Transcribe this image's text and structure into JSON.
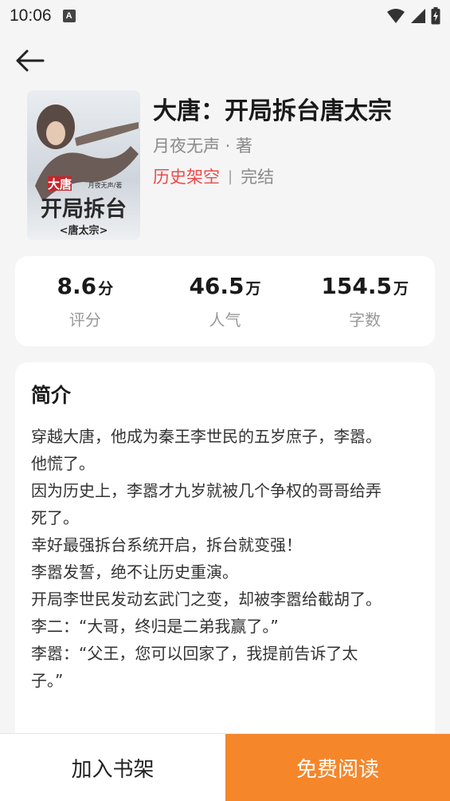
{
  "status_bar": {
    "time": "10:06",
    "notification_letter": "A",
    "icons": [
      "wifi-icon",
      "cell-signal-icon",
      "battery-icon"
    ]
  },
  "header": {
    "back_icon": "arrow-left-icon"
  },
  "book": {
    "cover_texts": {
      "big": "大唐",
      "main": "开局拆台",
      "sub": "<唐太宗>",
      "author": "月夜无声/著"
    },
    "title": "大唐：开局拆台唐太宗",
    "author": "月夜无声 · 著",
    "category": "历史架空",
    "separator": "|",
    "status": "完结"
  },
  "stats": [
    {
      "value": "8.6",
      "unit": "分",
      "label": "评分"
    },
    {
      "value": "46.5",
      "unit": "万",
      "label": "人气"
    },
    {
      "value": "154.5",
      "unit": "万",
      "label": "字数"
    }
  ],
  "intro": {
    "heading": "简介",
    "lines": [
      "穿越大唐，他成为秦王李世民的五岁庶子，李嚣。",
      "他慌了。",
      "因为历史上，李嚣才九岁就被几个争权的哥哥给弄",
      "死了。",
      "幸好最强拆台系统开启，拆台就变强！",
      "李嚣发誓，绝不让历史重演。",
      "开局李世民发动玄武门之变，却被李嚣给截胡了。",
      "李二：“大哥，终归是二弟我赢了。”",
      "李嚣：“父王，您可以回家了，我提前告诉了太",
      "子。”"
    ]
  },
  "actions": {
    "add_shelf": "加入书架",
    "read_free": "免费阅读"
  },
  "colors": {
    "accent_orange": "#f5862a",
    "category_red": "#ec4a4a",
    "background": "#f5f5f5"
  }
}
